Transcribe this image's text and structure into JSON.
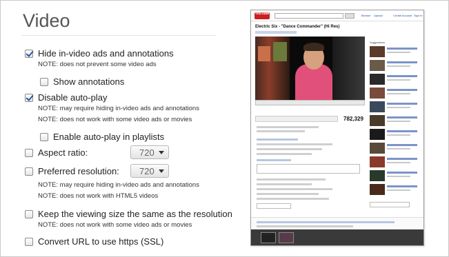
{
  "section_title": "Video",
  "options": {
    "hide_ads": {
      "label": "Hide in-video ads and annotations",
      "checked": true,
      "note": "NOTE: does not prevent some video ads"
    },
    "show_annotations": {
      "label": "Show annotations",
      "checked": false
    },
    "disable_autoplay": {
      "label": "Disable auto-play",
      "checked": true,
      "note1": "NOTE: may require hiding in-video ads and annotations",
      "note2": "NOTE: does not work with some video ads or movies"
    },
    "autoplay_playlists": {
      "label": "Enable auto-play in playlists",
      "checked": false
    },
    "aspect_ratio": {
      "label": "Aspect ratio:",
      "checked": false,
      "value": "720"
    },
    "preferred_resolution": {
      "label": "Preferred resolution:",
      "checked": false,
      "value": "720",
      "note1": "NOTE: may require hiding in-video ads and annotations",
      "note2": "NOTE: does not work with HTML5 videos"
    },
    "keep_size": {
      "label": "Keep the viewing size the same as the resolution",
      "checked": false,
      "note": "NOTE: does not work with some video ads or movies"
    },
    "https": {
      "label": "Convert URL to use https (SSL)",
      "checked": false
    }
  },
  "preview": {
    "logo": "YouTube",
    "video_title": "Electric Six - \"Dance Commander\" (Hi Res)",
    "view_count": "782,329",
    "links": [
      "Browse",
      "Upload",
      "Create Account",
      "Sign In"
    ],
    "suggestions_label": "Suggestions"
  },
  "colors": {
    "checkmark": "#2a55a0",
    "title": "#555555",
    "preview_accent": "#cc2020"
  }
}
